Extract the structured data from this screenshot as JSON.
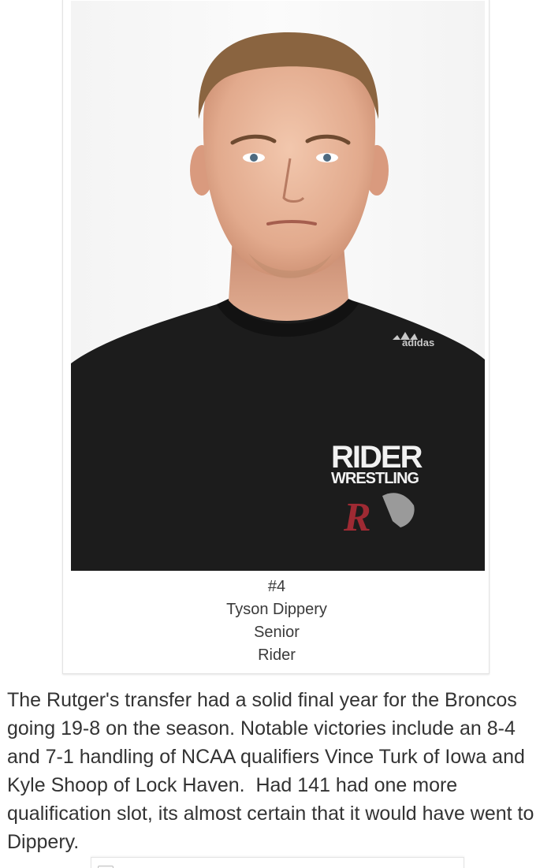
{
  "profile": {
    "photo_icon": "wrestler-headshot",
    "shirt_brand": "adidas",
    "shirt_logo_line1": "RIDER",
    "shirt_logo_line2": "WRESTLING",
    "shirt_mascot_letter": "R",
    "number": "#4",
    "name": "Tyson Dippery",
    "year": "Senior",
    "school": "Rider"
  },
  "article": {
    "paragraph": "The Rutger's transfer had a solid final year for the Broncos going 19-8 on the season. Notable victories include an 8-4 and 7-1 handling of NCAA qualifiers Vince Turk of Iowa and Kyle Shoop of Lock Haven.  Had 141 had one more qualification slot, its almost certain that it would have went to Dippery."
  },
  "next_card": {
    "icon": "broken-image-icon"
  },
  "colors": {
    "text": "#333333",
    "caption_text": "#3a3a3a",
    "shirt": "#1b1b1b",
    "logo_red": "#9e2a33"
  }
}
